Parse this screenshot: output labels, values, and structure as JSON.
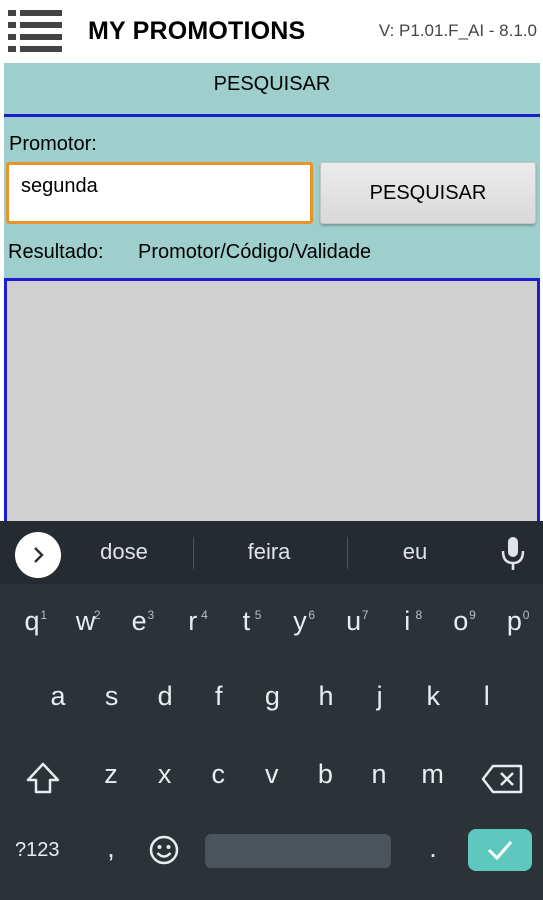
{
  "app": {
    "title": "MY PROMOTIONS",
    "version": "V: P1.01.F_AI - 8.1.0"
  },
  "section": {
    "title": "PESQUISAR"
  },
  "form": {
    "promotor_label": "Promotor:",
    "search_value": "segunda",
    "search_button_label": "PESQUISAR",
    "result_label": "Resultado:",
    "result_columns": "Promotor/Código/Validade"
  },
  "results": [],
  "keyboard": {
    "suggestions": [
      "dose",
      "feira",
      "eu"
    ],
    "row1": [
      {
        "char": "q",
        "hint": "1"
      },
      {
        "char": "w",
        "hint": "2"
      },
      {
        "char": "e",
        "hint": "3"
      },
      {
        "char": "r",
        "hint": "4"
      },
      {
        "char": "t",
        "hint": "5"
      },
      {
        "char": "y",
        "hint": "6"
      },
      {
        "char": "u",
        "hint": "7"
      },
      {
        "char": "i",
        "hint": "8"
      },
      {
        "char": "o",
        "hint": "9"
      },
      {
        "char": "p",
        "hint": "0"
      }
    ],
    "row2": [
      "a",
      "s",
      "d",
      "f",
      "g",
      "h",
      "j",
      "k",
      "l"
    ],
    "row3": [
      "z",
      "x",
      "c",
      "v",
      "b",
      "n",
      "m"
    ],
    "symbols_label": "?123",
    "comma": ",",
    "period": "."
  },
  "colors": {
    "panel": "#9fcfcd",
    "accent_border": "#1d1dcf",
    "input_focus": "#e8942a",
    "keyboard_bg": "#2b3238",
    "enter_key": "#5fc8be"
  }
}
